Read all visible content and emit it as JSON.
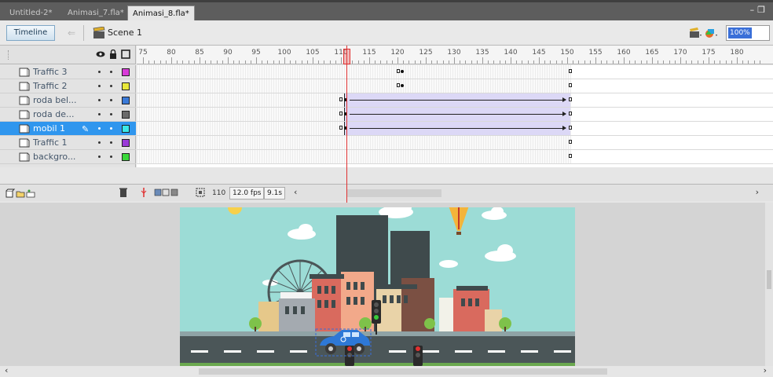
{
  "doc_tabs": [
    {
      "label": "Untitled-2*",
      "active": false
    },
    {
      "label": "Animasi_7.fla*",
      "active": false
    },
    {
      "label": "Animasi_8.fla*",
      "active": true
    }
  ],
  "edit_bar": {
    "timeline_label": "Timeline",
    "scene_label": "Scene 1",
    "zoom": "100%"
  },
  "ruler": {
    "numbers": [
      "75",
      "80",
      "85",
      "90",
      "95",
      "100",
      "105",
      "110",
      "115",
      "120",
      "125",
      "130",
      "135",
      "140",
      "145",
      "150",
      "155",
      "160",
      "165",
      "170",
      "175",
      "180"
    ]
  },
  "layers": [
    {
      "name": "Traffic 3",
      "color": "#d83ad8",
      "selected": false
    },
    {
      "name": "Traffic 2",
      "color": "#e8e83a",
      "selected": false
    },
    {
      "name": "roda bel...",
      "color": "#3a7ad8",
      "selected": false
    },
    {
      "name": "roda de...",
      "color": "#6a6a6a",
      "selected": false
    },
    {
      "name": "mobil 1",
      "color": "#3ae8e8",
      "selected": true
    },
    {
      "name": "Traffic 1",
      "color": "#9a3ad8",
      "selected": false
    },
    {
      "name": "backgro...",
      "color": "#3ad83a",
      "selected": false
    }
  ],
  "footer": {
    "current_frame": "110",
    "fps": "12.0 fps",
    "elapsed": "9.1s"
  },
  "colors": {
    "selected_layer": "#2f96ee",
    "tween_fill": "#dcd8f6",
    "playhead": "#e03030",
    "sky": "#9cdcd6",
    "road": "#4b5658"
  }
}
